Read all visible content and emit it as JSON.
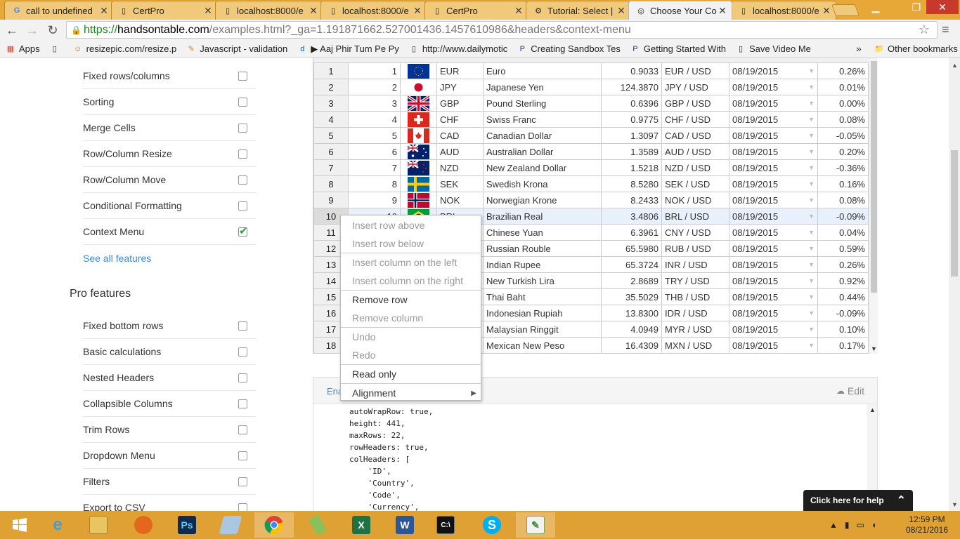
{
  "browser": {
    "tabs": [
      {
        "title": "call to undefined",
        "icon": "google-g-icon",
        "active": false
      },
      {
        "title": "CertPro",
        "icon": "page-icon",
        "active": false
      },
      {
        "title": "localhost:8000/e",
        "icon": "page-icon",
        "active": false
      },
      {
        "title": "localhost:8000/e",
        "icon": "page-icon",
        "active": false
      },
      {
        "title": "CertPro",
        "icon": "page-icon",
        "active": false
      },
      {
        "title": "Tutorial: Select | I",
        "icon": "gear-icon",
        "active": false
      },
      {
        "title": "Choose Your Co",
        "icon": "handsontable-icon",
        "active": true
      },
      {
        "title": "localhost:8000/e",
        "icon": "page-icon",
        "active": false
      }
    ],
    "close_glyph": "✕",
    "url": {
      "scheme": "https://",
      "host": "handsontable.com",
      "rest": "/examples.html?_ga=1.191871662.527001436.1457610986&headers&context-menu"
    },
    "bookmarks": [
      {
        "label": "Apps",
        "icon": "apps-grid-icon"
      },
      {
        "label": "",
        "icon": "page-icon"
      },
      {
        "label": "resizepic.com/resize.p",
        "icon": "resizepic-icon"
      },
      {
        "label": "Javascript - validation",
        "icon": "javascript-icon"
      },
      {
        "label": "▶ Aaj Phir Tum Pe Py",
        "icon": "dailymotion-icon"
      },
      {
        "label": "http://www.dailymotic",
        "icon": "page-icon"
      },
      {
        "label": "Creating Sandbox Tes",
        "icon": "paypal-icon"
      },
      {
        "label": "Getting Started With",
        "icon": "paypal-icon"
      },
      {
        "label": "Save Video Me",
        "icon": "page-icon"
      }
    ],
    "bookmarks_overflow": "»",
    "other_bookmarks": "Other bookmarks"
  },
  "sidebar": {
    "features": [
      {
        "label": "Fixed rows/columns",
        "checked": false
      },
      {
        "label": "Sorting",
        "checked": false
      },
      {
        "label": "Merge Cells",
        "checked": false
      },
      {
        "label": "Row/Column Resize",
        "checked": false
      },
      {
        "label": "Row/Column Move",
        "checked": false
      },
      {
        "label": "Conditional Formatting",
        "checked": false
      },
      {
        "label": "Context Menu",
        "checked": true
      }
    ],
    "see_all": "See all features",
    "pro_title": "Pro features",
    "pro_features": [
      {
        "label": "Fixed bottom rows",
        "checked": false
      },
      {
        "label": "Basic calculations",
        "checked": false
      },
      {
        "label": "Nested Headers",
        "checked": false
      },
      {
        "label": "Collapsible Columns",
        "checked": false
      },
      {
        "label": "Trim Rows",
        "checked": false
      },
      {
        "label": "Dropdown Menu",
        "checked": false
      },
      {
        "label": "Filters",
        "checked": false
      },
      {
        "label": "Export to CSV",
        "checked": false
      }
    ]
  },
  "grid": {
    "rows": [
      {
        "rh": "1",
        "id": "1",
        "flag": "eu",
        "code": "EUR",
        "name": "Euro",
        "rate": "0.9033",
        "pair": "EUR / USD",
        "date": "08/19/2015",
        "change": "0.26%"
      },
      {
        "rh": "2",
        "id": "2",
        "flag": "jp",
        "code": "JPY",
        "name": "Japanese Yen",
        "rate": "124.3870",
        "pair": "JPY / USD",
        "date": "08/19/2015",
        "change": "0.01%"
      },
      {
        "rh": "3",
        "id": "3",
        "flag": "gb",
        "code": "GBP",
        "name": "Pound Sterling",
        "rate": "0.6396",
        "pair": "GBP / USD",
        "date": "08/19/2015",
        "change": "0.00%"
      },
      {
        "rh": "4",
        "id": "4",
        "flag": "ch",
        "code": "CHF",
        "name": "Swiss Franc",
        "rate": "0.9775",
        "pair": "CHF / USD",
        "date": "08/19/2015",
        "change": "0.08%"
      },
      {
        "rh": "5",
        "id": "5",
        "flag": "ca",
        "code": "CAD",
        "name": "Canadian Dollar",
        "rate": "1.3097",
        "pair": "CAD / USD",
        "date": "08/19/2015",
        "change": "-0.05%"
      },
      {
        "rh": "6",
        "id": "6",
        "flag": "au",
        "code": "AUD",
        "name": "Australian Dollar",
        "rate": "1.3589",
        "pair": "AUD / USD",
        "date": "08/19/2015",
        "change": "0.20%"
      },
      {
        "rh": "7",
        "id": "7",
        "flag": "nz",
        "code": "NZD",
        "name": "New Zealand Dollar",
        "rate": "1.5218",
        "pair": "NZD / USD",
        "date": "08/19/2015",
        "change": "-0.36%"
      },
      {
        "rh": "8",
        "id": "8",
        "flag": "se",
        "code": "SEK",
        "name": "Swedish Krona",
        "rate": "8.5280",
        "pair": "SEK / USD",
        "date": "08/19/2015",
        "change": "0.16%"
      },
      {
        "rh": "9",
        "id": "9",
        "flag": "no",
        "code": "NOK",
        "name": "Norwegian Krone",
        "rate": "8.2433",
        "pair": "NOK / USD",
        "date": "08/19/2015",
        "change": "0.08%"
      },
      {
        "rh": "10",
        "id": "10",
        "flag": "br",
        "code": "BRL",
        "name": "Brazilian Real",
        "rate": "3.4806",
        "pair": "BRL / USD",
        "date": "08/19/2015",
        "change": "-0.09%"
      },
      {
        "rh": "11",
        "id": "",
        "flag": "",
        "code": "",
        "name": "Chinese Yuan",
        "rate": "6.3961",
        "pair": "CNY / USD",
        "date": "08/19/2015",
        "change": "0.04%"
      },
      {
        "rh": "12",
        "id": "",
        "flag": "",
        "code": "",
        "name": "Russian Rouble",
        "rate": "65.5980",
        "pair": "RUB / USD",
        "date": "08/19/2015",
        "change": "0.59%"
      },
      {
        "rh": "13",
        "id": "",
        "flag": "",
        "code": "",
        "name": "Indian Rupee",
        "rate": "65.3724",
        "pair": "INR / USD",
        "date": "08/19/2015",
        "change": "0.26%"
      },
      {
        "rh": "14",
        "id": "",
        "flag": "",
        "code": "",
        "name": "New Turkish Lira",
        "rate": "2.8689",
        "pair": "TRY / USD",
        "date": "08/19/2015",
        "change": "0.92%"
      },
      {
        "rh": "15",
        "id": "",
        "flag": "",
        "code": "",
        "name": "Thai Baht",
        "rate": "35.5029",
        "pair": "THB / USD",
        "date": "08/19/2015",
        "change": "0.44%"
      },
      {
        "rh": "16",
        "id": "",
        "flag": "",
        "code": "",
        "name": "Indonesian Rupiah",
        "rate": "13.8300",
        "pair": "IDR / USD",
        "date": "08/19/2015",
        "change": "-0.09%"
      },
      {
        "rh": "17",
        "id": "",
        "flag": "",
        "code": "",
        "name": "Malaysian Ringgit",
        "rate": "4.0949",
        "pair": "MYR / USD",
        "date": "08/19/2015",
        "change": "0.10%"
      },
      {
        "rh": "18",
        "id": "",
        "flag": "",
        "code": "",
        "name": "Mexican New Peso",
        "rate": "16.4309",
        "pair": "MXN / USD",
        "date": "08/19/2015",
        "change": "0.17%"
      }
    ],
    "dropdown_glyph": "▼",
    "selected_row": "10"
  },
  "context_menu": {
    "items": [
      {
        "label": "Insert row above",
        "disabled": true
      },
      {
        "label": "Insert row below",
        "disabled": true
      },
      {
        "label": "Insert column on the left",
        "disabled": true,
        "sep_before": true
      },
      {
        "label": "Insert column on the right",
        "disabled": true
      },
      {
        "label": "Remove row",
        "disabled": false,
        "sep_before": true
      },
      {
        "label": "Remove column",
        "disabled": true
      },
      {
        "label": "Undo",
        "disabled": true,
        "sep_before": true
      },
      {
        "label": "Redo",
        "disabled": true
      },
      {
        "label": "Read only",
        "disabled": false,
        "sep_before": true
      },
      {
        "label": "Alignment",
        "disabled": false,
        "sep_before": true,
        "submenu": true
      }
    ],
    "submenu_glyph": "▶"
  },
  "code_panel": {
    "lang_label": "Ena",
    "edit_label": "Edit",
    "code": "autoWrapRow: true,\nheight: 441,\nmaxRows: 22,\nrowHeaders: true,\ncolHeaders: [\n    'ID',\n    'Country',\n    'Code',\n    'Currency',"
  },
  "help_badge": {
    "label": "Click here for help",
    "chevron": "⌃"
  },
  "taskbar": {
    "clock_time": "12:59 PM",
    "clock_date": "08/21/2016"
  },
  "colors": {
    "accent_link": "#3a8bd6",
    "checked_green": "#2ea043",
    "taskbar": "#e0a134",
    "selected_row": "#e8f0fb"
  }
}
